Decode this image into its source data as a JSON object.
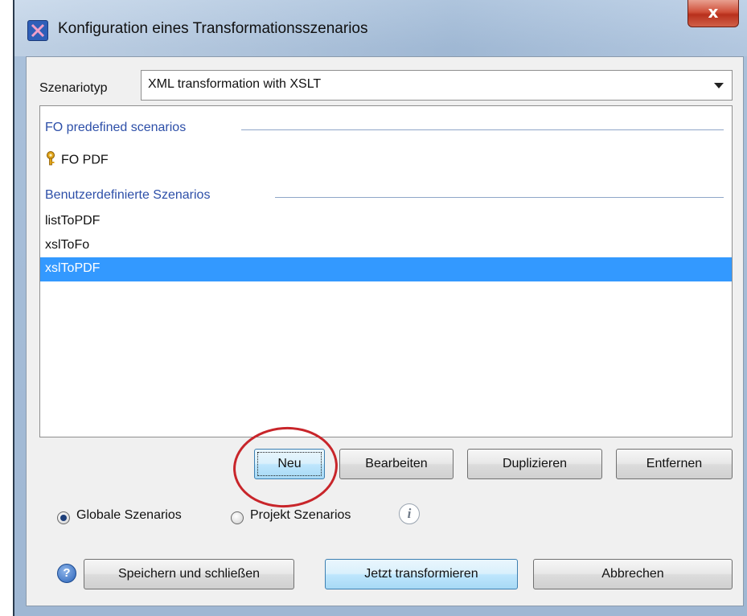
{
  "window": {
    "title": "Konfiguration eines Transformationsszenarios",
    "close_label": "x"
  },
  "scenario_type": {
    "label": "Szenariotyp",
    "selected": "XML transformation with XSLT"
  },
  "scenario_list": {
    "groups": [
      {
        "title": "FO predefined scenarios",
        "items": [
          {
            "label": "FO PDF",
            "icon": "key-icon"
          }
        ]
      },
      {
        "title": "Benutzerdefinierte Szenarios",
        "items": [
          {
            "label": "listToPDF"
          },
          {
            "label": "xslToFo"
          },
          {
            "label": "xslToPDF",
            "selected": true
          }
        ]
      }
    ]
  },
  "list_buttons": {
    "new": "Neu",
    "edit": "Bearbeiten",
    "duplicate": "Duplizieren",
    "remove": "Entfernen"
  },
  "scope": {
    "global_label": "Globale Szenarios",
    "project_label": "Projekt Szenarios",
    "selected": "global",
    "info_icon": "i"
  },
  "footer": {
    "help_icon": "?",
    "save_close": "Speichern und schließen",
    "transform_now": "Jetzt transformieren",
    "cancel": "Abbrechen"
  },
  "colors": {
    "selection": "#3399ff",
    "group_header": "#2d4fa8",
    "highlight_circle": "#c8252a"
  }
}
